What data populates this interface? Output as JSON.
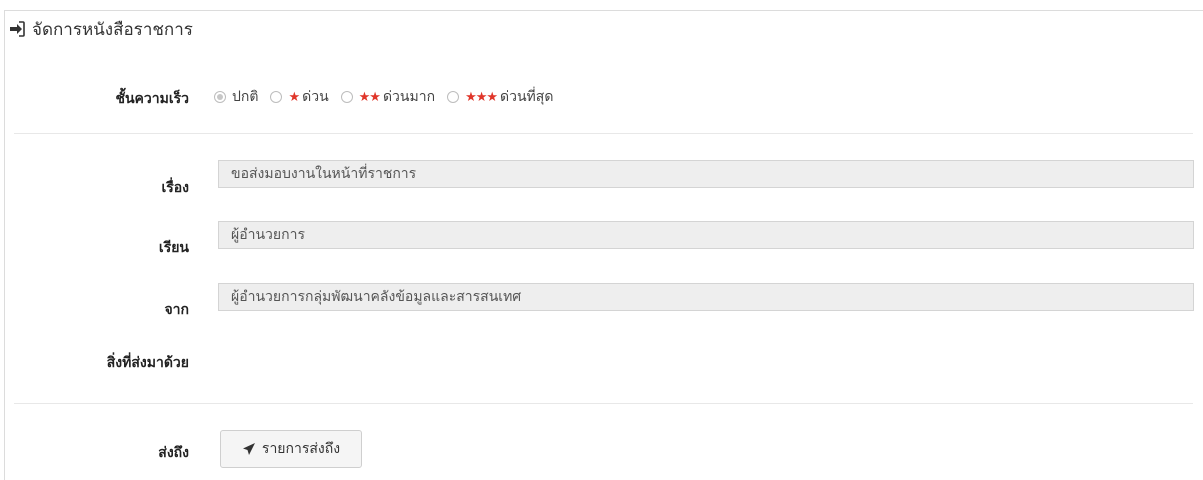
{
  "panel": {
    "title": "จัดการหนังสือราชการ",
    "title_icon": "sign-in-icon"
  },
  "priority": {
    "label": "ชั้นความเร็ว",
    "options": [
      {
        "label": "ปกติ",
        "stars": "",
        "checked": true
      },
      {
        "label": "ด่วน",
        "stars": "★",
        "checked": false
      },
      {
        "label": "ด่วนมาก",
        "stars": "★★",
        "checked": false
      },
      {
        "label": "ด่วนที่สุด",
        "stars": "★★★",
        "checked": false
      }
    ],
    "star_color": "#e0362a"
  },
  "subject": {
    "label": "เรื่อง",
    "value": "ขอส่งมอบงานในหน้าที่ราชการ"
  },
  "to": {
    "label": "เรียน",
    "value": "ผู้อำนวยการ"
  },
  "from": {
    "label": "จาก",
    "value": "ผู้อำนวยการกลุ่มพัฒนาคลังข้อมูลและสารสนเทศ"
  },
  "attachments": {
    "label": "สิ่งที่ส่งมาด้วย"
  },
  "send": {
    "label": "ส่งถึง",
    "button_label": "รายการส่งถึง",
    "button_icon": "paper-plane-icon"
  }
}
